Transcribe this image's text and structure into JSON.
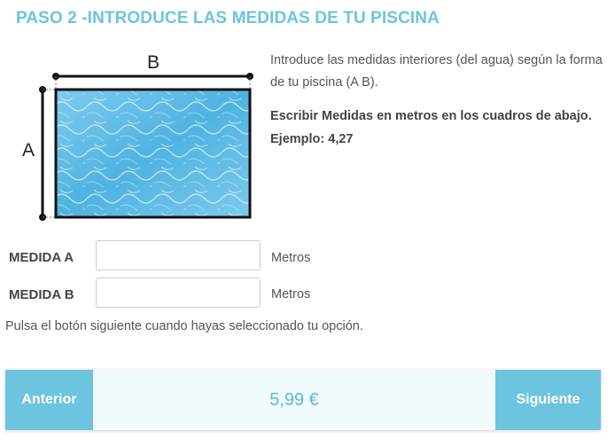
{
  "header": {
    "title": "PASO 2 -INTRODUCE LAS MEDIDAS DE TU PISCINA"
  },
  "diagram": {
    "label_b": "B",
    "label_a": "A",
    "water_color": "#4fb3e0",
    "frame_color": "#111111"
  },
  "instructions": {
    "text": "Introduce las medidas interiores (del agua) según la forma de tu piscina (A B).",
    "emphasis": "Escribir Medidas en metros en los cuadros de abajo. Ejemplo: 4,27"
  },
  "form": {
    "measure_a": {
      "label": "MEDIDA A",
      "value": "",
      "unit": "Metros"
    },
    "measure_b": {
      "label": "MEDIDA B",
      "value": "",
      "unit": "Metros"
    },
    "hint": "Pulsa el botón siguiente cuando hayas seleccionado tu opción."
  },
  "footer": {
    "prev_label": "Anterior",
    "price": "5,99 €",
    "next_label": "Siguiente"
  },
  "colors": {
    "accent": "#6cc4de",
    "bar_background": "#f1fafd"
  }
}
